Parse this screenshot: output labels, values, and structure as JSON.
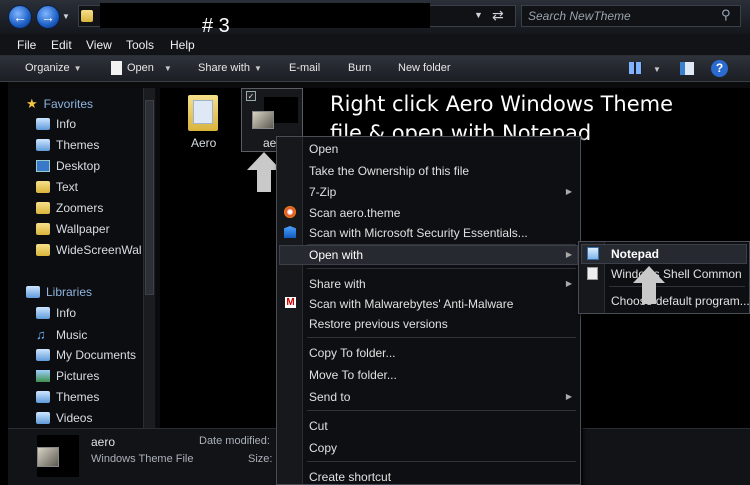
{
  "annotation": {
    "step": "# 3",
    "headline_line1": "Right click Aero Windows Theme",
    "headline_line2": "file & open with Notepad"
  },
  "search": {
    "placeholder": "Search NewTheme"
  },
  "menubar": [
    "File",
    "Edit",
    "View",
    "Tools",
    "Help"
  ],
  "toolbar": {
    "organize": "Organize",
    "open": "Open",
    "share_with": "Share with",
    "email": "E-mail",
    "burn": "Burn",
    "new_folder": "New folder"
  },
  "nav": {
    "favorites": "Favorites",
    "fav_items": [
      "Info",
      "Themes",
      "Desktop",
      "Text",
      "Zoomers",
      "Wallpaper",
      "WideScreenWal"
    ],
    "libraries": "Libraries",
    "lib_items": [
      "Info",
      "Music",
      "My Documents",
      "Pictures",
      "Themes",
      "Videos"
    ]
  },
  "files": {
    "folder_label": "Aero",
    "theme_label": "ae"
  },
  "context_menu": {
    "items": [
      "Open",
      "Take the Ownership of this file",
      "7-Zip",
      "Scan aero.theme",
      "Scan with Microsoft Security Essentials...",
      "Open with",
      "Share with",
      "Scan with Malwarebytes' Anti-Malware",
      "Restore previous versions",
      "Copy To folder...",
      "Move To folder...",
      "Send to",
      "Cut",
      "Copy",
      "Create shortcut"
    ]
  },
  "submenu": {
    "notepad": "Notepad",
    "shell": "Windows Shell Common",
    "choose": "Choose default program..."
  },
  "details": {
    "name": "aero",
    "type": "Windows Theme File",
    "date_label": "Date modified:",
    "size_label": "Size:"
  },
  "colors": {
    "accent": "#2b6cd4",
    "background": "#000000"
  }
}
